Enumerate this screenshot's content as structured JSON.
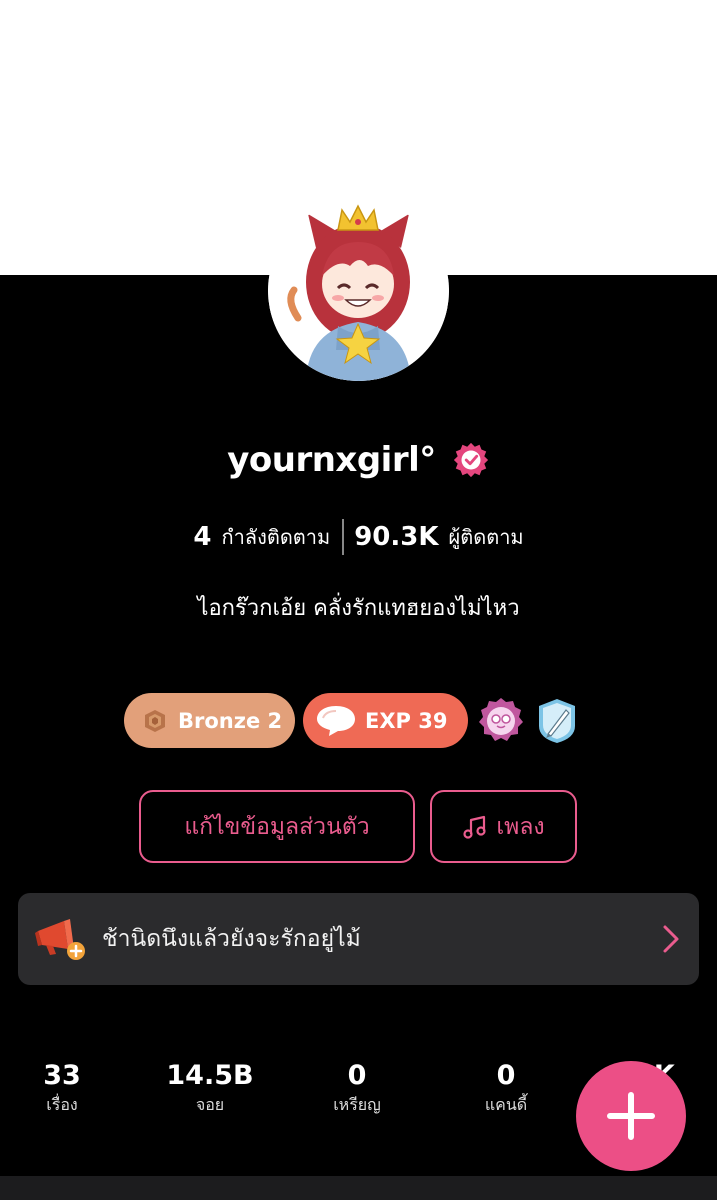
{
  "profile": {
    "username": "yournxgirl°",
    "following_count": "4",
    "following_label": "กำลังติดตาม",
    "followers_count": "90.3K",
    "followers_label": "ผู้ติดตาม",
    "bio": "ไอกร๊วกเอ้ย คลั่งรักแทฮยองไม่ไหว"
  },
  "badges": {
    "rank_label": "Bronze 2",
    "exp_label": "EXP 39"
  },
  "actions": {
    "edit_profile_label": "แก้ไขข้อมูลส่วนตัว",
    "music_label": "เพลง"
  },
  "announcement": {
    "text": "ช้านิดนึงแล้วยังจะรักอยู่ไม้"
  },
  "stats": [
    {
      "value": "33",
      "label": "เรื่อง"
    },
    {
      "value": "14.5B",
      "label": "จอย"
    },
    {
      "value": "0",
      "label": "เหรียญ"
    },
    {
      "value": "0",
      "label": "แคนดี้"
    },
    {
      "value": "1K",
      "label": ""
    }
  ],
  "colors": {
    "accent_pink": "#ec4f86",
    "bronze": "#e2a07a",
    "exp": "#ef6a55",
    "card": "#2b2b2d"
  },
  "icons": {
    "verified": "verified-badge-icon",
    "rank": "bronze-medal-icon",
    "exp": "speech-bubble-icon",
    "music": "music-note-icon",
    "announce": "megaphone-icon",
    "chevron": "chevron-right-icon",
    "fab": "plus-icon"
  }
}
